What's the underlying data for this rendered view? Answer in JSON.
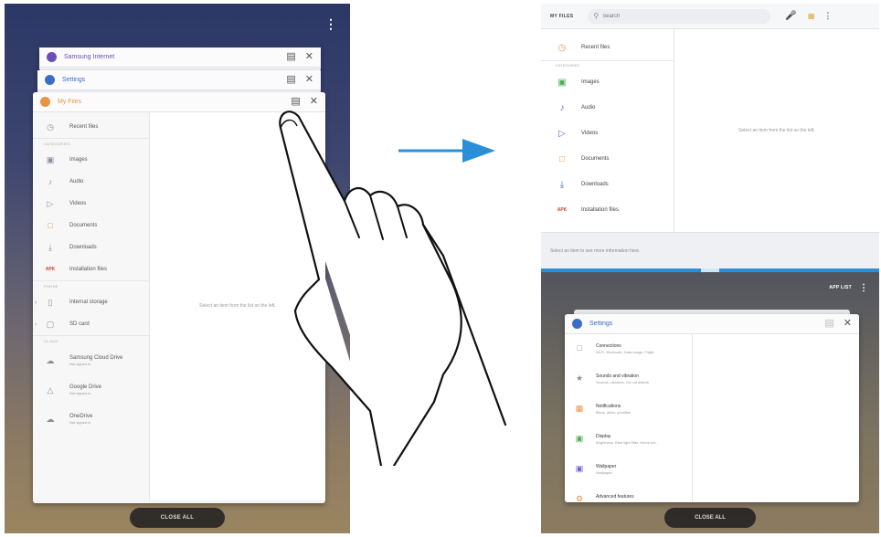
{
  "left": {
    "menu_icon": "more-vertical-icon",
    "cards": [
      {
        "name": "Samsung Internet",
        "color": "#6a4fb8"
      },
      {
        "name": "Settings",
        "color": "#3b6dc7"
      },
      {
        "name": "My Files",
        "color": "#e99443"
      }
    ],
    "files": {
      "recent": "Recent files",
      "categories_label": "CATEGORIES",
      "categories": [
        {
          "label": "Images",
          "icon": "image-icon"
        },
        {
          "label": "Audio",
          "icon": "music-note-icon"
        },
        {
          "label": "Videos",
          "icon": "video-icon"
        },
        {
          "label": "Documents",
          "icon": "document-icon"
        },
        {
          "label": "Downloads",
          "icon": "download-icon"
        },
        {
          "label": "Installation files",
          "icon": "apk-icon"
        }
      ],
      "phone_label": "PHONE",
      "storage": [
        {
          "label": "Internal storage",
          "icon": "phone-icon"
        },
        {
          "label": "SD card",
          "icon": "sd-card-icon"
        }
      ],
      "cloud_label": "CLOUD",
      "cloud": [
        {
          "label": "Samsung Cloud Drive",
          "sub": "Not signed in",
          "icon": "cloud-icon"
        },
        {
          "label": "Google Drive",
          "sub": "Not signed in",
          "icon": "google-drive-icon"
        },
        {
          "label": "OneDrive",
          "sub": "Not signed in",
          "icon": "onedrive-icon"
        }
      ],
      "empty_message": "Select an item from the list on the left."
    },
    "close_all": "CLOSE ALL"
  },
  "right": {
    "top_title": "MY FILES",
    "search_placeholder": "Search",
    "recent": "Recent files",
    "categories_label": "CATEGORIES",
    "categories": [
      {
        "label": "Images"
      },
      {
        "label": "Audio"
      },
      {
        "label": "Videos"
      },
      {
        "label": "Documents"
      },
      {
        "label": "Downloads"
      },
      {
        "label": "Installation files"
      }
    ],
    "empty_message": "Select an item from the list on the left.",
    "info_hint": "Select an item to see more information here.",
    "app_list": "APP LIST",
    "settings_title": "Settings",
    "settings_items": [
      {
        "label": "Connections",
        "sub": "Wi-Fi, Bluetooth, Data usage, Flight..."
      },
      {
        "label": "Sounds and vibration",
        "sub": "Sounds, vibration, Do not disturb"
      },
      {
        "label": "Notifications",
        "sub": "Block, allow, prioritise"
      },
      {
        "label": "Display",
        "sub": "Brightness, Blue light filter, Home scr..."
      },
      {
        "label": "Wallpaper",
        "sub": "Wallpaper"
      },
      {
        "label": "Advanced features",
        "sub": ""
      }
    ],
    "close_all": "CLOSE ALL"
  }
}
